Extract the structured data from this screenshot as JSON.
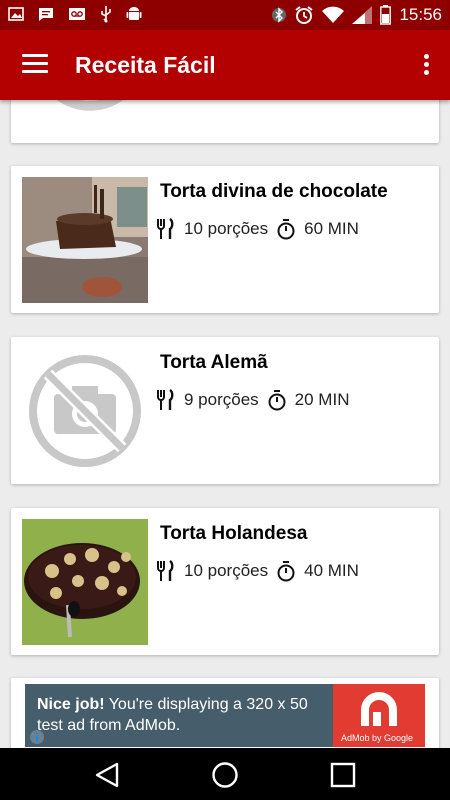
{
  "status_bar": {
    "time": "15:56"
  },
  "app_bar": {
    "title": "Receita Fácil"
  },
  "recipes": [
    {
      "title": "Torta divina de chocolate",
      "portions": "10 porções",
      "time": "60 MIN",
      "image": "chocolate-cake-photo"
    },
    {
      "title": "Torta Alemã",
      "portions": "9 porções",
      "time": "20 MIN",
      "image": "no-photo-placeholder"
    },
    {
      "title": "Torta Holandesa",
      "portions": "10 porções",
      "time": "40 MIN",
      "image": "dutch-pie-photo"
    }
  ],
  "ad": {
    "headline": "Nice job!",
    "body": " You're displaying a 320 x 50 test ad from AdMob.",
    "logo_label": "AdMob by Google"
  },
  "colors": {
    "status_bar": "#8e0000",
    "app_bar": "#b30000",
    "ad_bg": "#465e6b",
    "ad_logo": "#e23b32"
  }
}
